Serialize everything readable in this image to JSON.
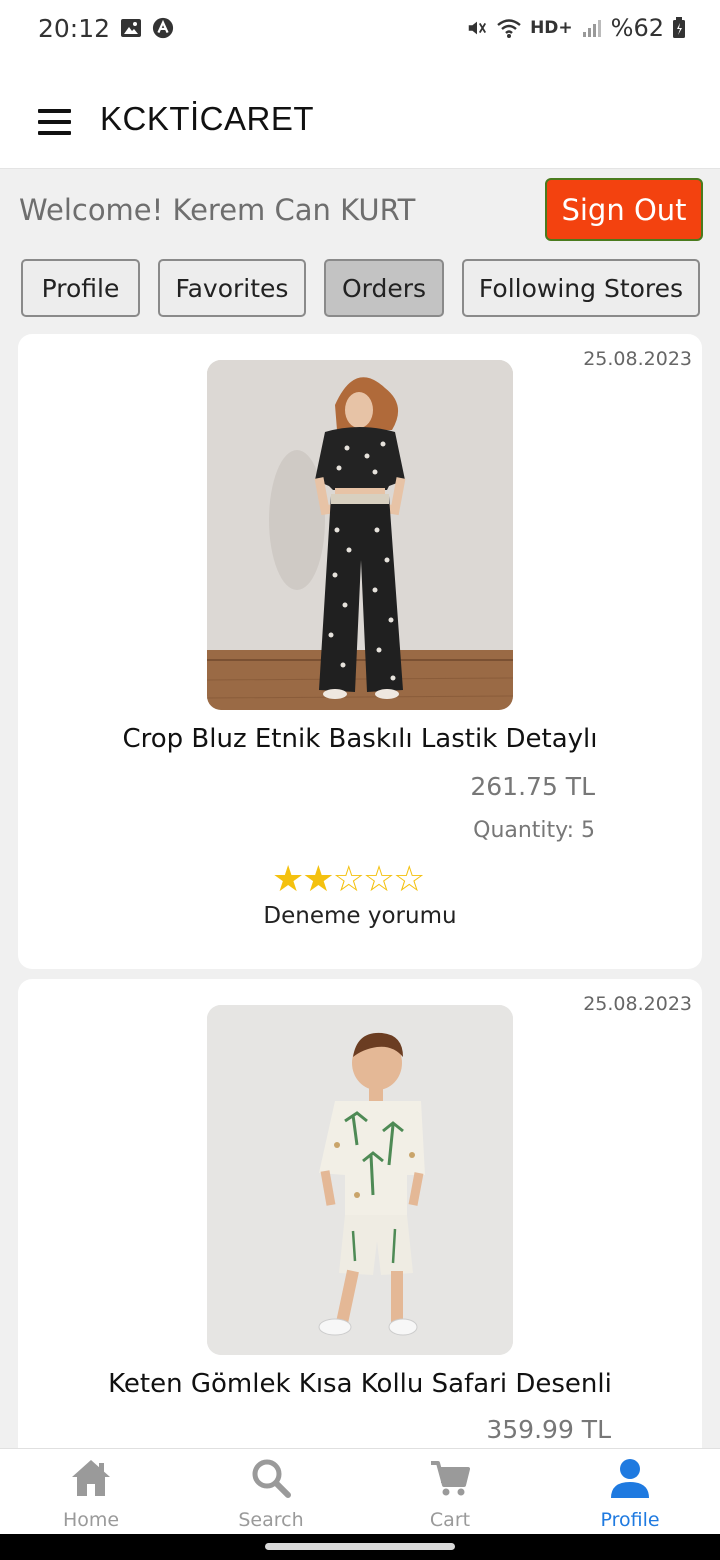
{
  "status_bar": {
    "time": "20:12",
    "network": "HD+",
    "battery": "%62"
  },
  "app_bar": {
    "title": "KCKTİCARET"
  },
  "welcome": {
    "text": "Welcome! Kerem Can KURT",
    "sign_out_label": "Sign Out"
  },
  "tabs": [
    {
      "label": "Profile",
      "active": false
    },
    {
      "label": "Favorites",
      "active": false
    },
    {
      "label": "Orders",
      "active": true
    },
    {
      "label": "Following Stores",
      "active": false
    }
  ],
  "orders": [
    {
      "date": "25.08.2023",
      "name": "Crop Bluz Etnik Baskılı Lastik Detaylı",
      "price": "261.75 TL",
      "quantity": "Quantity: 5",
      "rating": 2,
      "rating_max": 5,
      "review": "Deneme yorumu"
    },
    {
      "date": "25.08.2023",
      "name": "Keten Gömlek Kısa Kollu Safari Desenli",
      "price": "359.99 TL"
    }
  ],
  "bottom_nav": [
    {
      "label": "Home",
      "icon": "home-icon",
      "active": false
    },
    {
      "label": "Search",
      "icon": "search-icon",
      "active": false
    },
    {
      "label": "Cart",
      "icon": "cart-icon",
      "active": false
    },
    {
      "label": "Profile",
      "icon": "person-icon",
      "active": true
    }
  ],
  "colors": {
    "accent": "#1f7ae0",
    "sign_out": "#f3420f",
    "star": "#f4c10f"
  }
}
